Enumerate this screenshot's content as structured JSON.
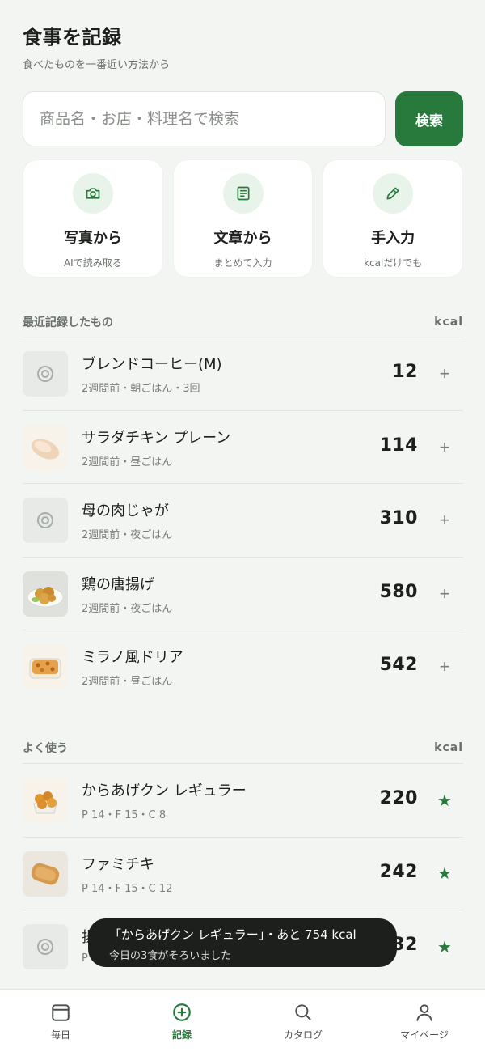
{
  "header": {
    "title": "食事を記録",
    "subtitle": "食べたものを一番近い方法から"
  },
  "search": {
    "placeholder": "商品名・お店・料理名で検索",
    "button_label": "検索"
  },
  "methods": [
    {
      "icon": "camera-icon",
      "title": "写真から",
      "sub": "AIで読み取る"
    },
    {
      "icon": "document-icon",
      "title": "文章から",
      "sub": "まとめて入力"
    },
    {
      "icon": "pencil-icon",
      "title": "手入力",
      "sub": "kcalだけでも"
    }
  ],
  "recent": {
    "heading": "最近記録したもの",
    "unit": "kcal",
    "items": [
      {
        "name": "ブレンドコーヒー(M)",
        "meta": "2週間前・朝ごはん・3回",
        "kcal": "12",
        "thumb": "placeholder-icon"
      },
      {
        "name": "サラダチキン プレーン",
        "meta": "2週間前・昼ごはん",
        "kcal": "114",
        "thumb": "chicken-breast"
      },
      {
        "name": "母の肉じゃが",
        "meta": "2週間前・夜ごはん",
        "kcal": "310",
        "thumb": "placeholder-icon"
      },
      {
        "name": "鶏の唐揚げ",
        "meta": "2週間前・夜ごはん",
        "kcal": "580",
        "thumb": "karaage-plate"
      },
      {
        "name": "ミラノ風ドリア",
        "meta": "2週間前・昼ごはん",
        "kcal": "542",
        "thumb": "doria"
      }
    ],
    "action": "+"
  },
  "favorites": {
    "heading": "よく使う",
    "unit": "kcal",
    "items": [
      {
        "name": "からあげクン レギュラー",
        "meta": "P 14・F 15・C 8",
        "kcal": "220",
        "thumb": "karaage-box"
      },
      {
        "name": "ファミチキ",
        "meta": "P 14・F 15・C 12",
        "kcal": "242",
        "thumb": "famichiki"
      },
      {
        "name": "揚",
        "meta": "P",
        "kcal": "32",
        "thumb": "placeholder-icon"
      }
    ],
    "action": "★"
  },
  "toast": {
    "main": "「からあげクン レギュラー」・あと 754 kcal",
    "sub": "今日の3食がそろいました"
  },
  "nav": [
    {
      "label": "毎日",
      "icon": "calendar-icon",
      "active": false
    },
    {
      "label": "記録",
      "icon": "plus-circle-icon",
      "active": true
    },
    {
      "label": "カタログ",
      "icon": "search-icon",
      "active": false
    },
    {
      "label": "マイページ",
      "icon": "person-icon",
      "active": false
    }
  ],
  "colors": {
    "accent": "#277a3c",
    "accent_light": "#e8f4ea",
    "background": "#f3f5f2",
    "toast": "#1c1f1c"
  }
}
